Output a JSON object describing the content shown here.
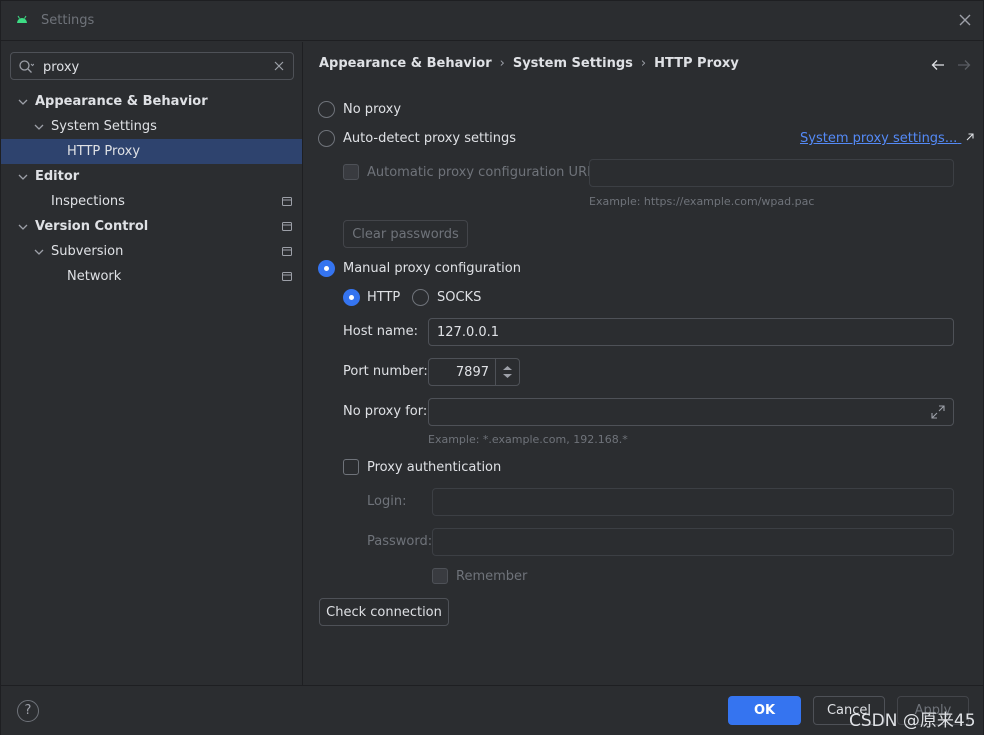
{
  "window": {
    "title": "Settings"
  },
  "search": {
    "value": "proxy"
  },
  "tree": [
    {
      "label": "Appearance & Behavior"
    },
    {
      "label": "System Settings"
    },
    {
      "label": "HTTP Proxy"
    },
    {
      "label": "Editor"
    },
    {
      "label": "Inspections"
    },
    {
      "label": "Version Control"
    },
    {
      "label": "Subversion"
    },
    {
      "label": "Network"
    }
  ],
  "breadcrumb": [
    "Appearance & Behavior",
    "System Settings",
    "HTTP Proxy"
  ],
  "proxy": {
    "no_proxy": "No proxy",
    "auto_detect": "Auto-detect proxy settings",
    "system_link": "System proxy settings...",
    "auto_url_label": "Automatic proxy configuration URL:",
    "auto_url_hint": "Example: https://example.com/wpad.pac",
    "clear_passwords": "Clear passwords",
    "manual": "Manual proxy configuration",
    "http": "HTTP",
    "socks": "SOCKS",
    "host_label": "Host name:",
    "host_value": "127.0.0.1",
    "port_label": "Port number:",
    "port_value": "7897",
    "no_proxy_for_label": "No proxy for:",
    "no_proxy_for_hint": "Example: *.example.com, 192.168.*",
    "auth_label": "Proxy authentication",
    "login_label": "Login:",
    "password_label": "Password:",
    "remember_label": "Remember",
    "check_connection": "Check connection"
  },
  "footer": {
    "help": "?",
    "ok": "OK",
    "cancel": "Cancel",
    "apply": "Apply",
    "watermark": "CSDN @原来45"
  },
  "colors": {
    "accent": "#3574f0",
    "link": "#548af7",
    "background": "#2b2d30",
    "selection": "#2e436e"
  },
  "icons": [
    "android-icon",
    "close-icon",
    "search-icon",
    "clear-icon",
    "chevron-down-icon",
    "project-icon",
    "back-arrow-icon",
    "forward-arrow-icon",
    "external-link-icon",
    "stepper-arrows-icon",
    "expand-icon",
    "help-icon"
  ]
}
